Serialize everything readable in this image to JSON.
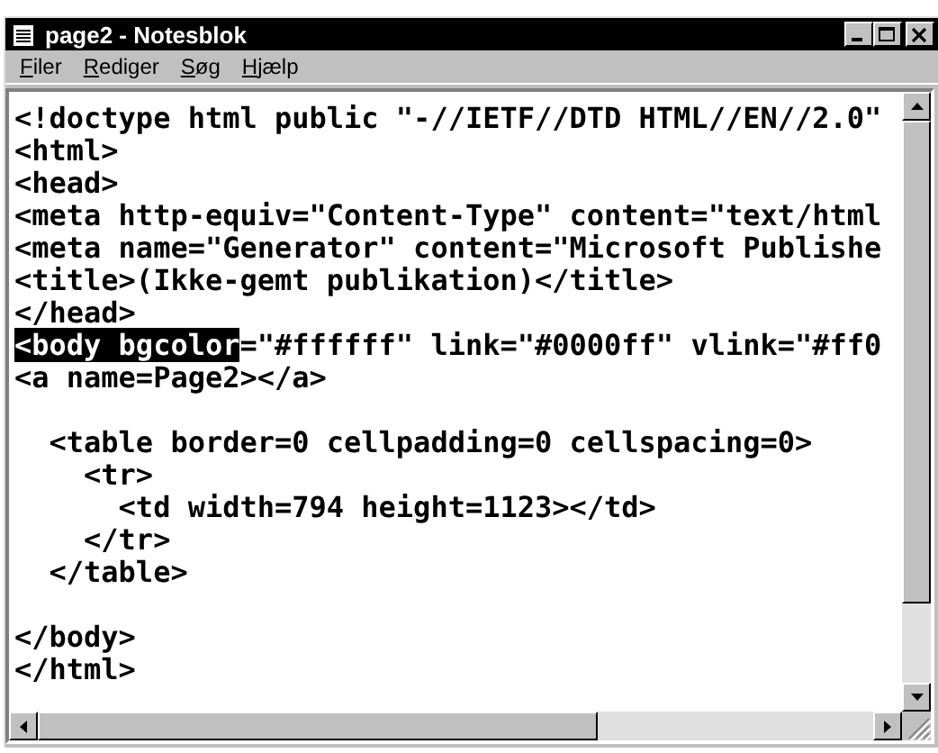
{
  "window": {
    "title": "page2 - Notesblok"
  },
  "menu": [
    {
      "label": "Filer"
    },
    {
      "label": "Rediger"
    },
    {
      "label": "Søg"
    },
    {
      "label": "Hjælp"
    }
  ],
  "editor": {
    "lines": [
      {
        "kind": "code",
        "text": "<!doctype html public \"-//IETF//DTD HTML//EN//2.0\""
      },
      {
        "kind": "code",
        "text": "<html>"
      },
      {
        "kind": "code",
        "text": "<head>"
      },
      {
        "kind": "code",
        "text": "<meta http-equiv=\"Content-Type\" content=\"text/html"
      },
      {
        "kind": "code",
        "text": "<meta name=\"Generator\" content=\"Microsoft Publishe"
      },
      {
        "kind": "code",
        "text": "<title>(Ikke-gemt publikation)</title>"
      },
      {
        "kind": "code",
        "text": "</head>"
      },
      {
        "kind": "code",
        "selection": "<body bgcolor",
        "text": "=\"#ffffff\" link=\"#0000ff\" vlink=\"#ff0"
      },
      {
        "kind": "code",
        "text": "<a name=Page2></a>"
      },
      {
        "kind": "blank"
      },
      {
        "kind": "code",
        "text": "  <table border=0 cellpadding=0 cellspacing=0>"
      },
      {
        "kind": "code",
        "text": "    <tr>"
      },
      {
        "kind": "code",
        "text": "      <td width=794 height=1123></td>"
      },
      {
        "kind": "code",
        "text": "    </tr>"
      },
      {
        "kind": "code",
        "text": "  </table>"
      },
      {
        "kind": "blank"
      },
      {
        "kind": "code",
        "text": "</body>"
      },
      {
        "kind": "code",
        "text": "</html>"
      }
    ]
  }
}
